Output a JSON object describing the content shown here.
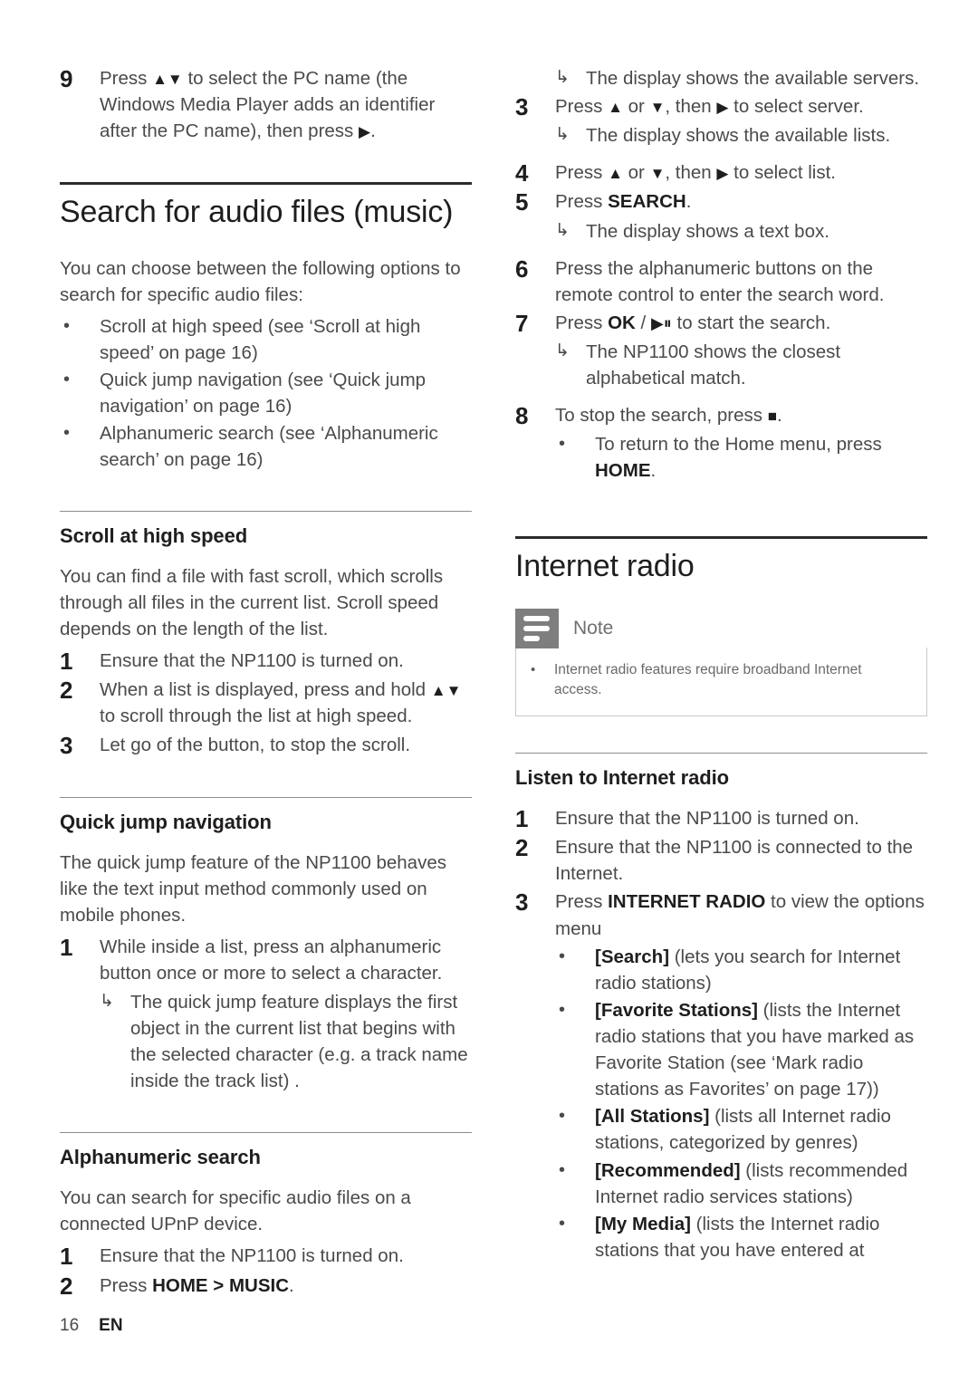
{
  "left_column": {
    "step9": {
      "number": "9",
      "text_before": "Press ",
      "glyph_updown": "▲▼",
      "text_mid": " to select the PC name (the Windows Media Player adds an identifier after the PC name), then press ",
      "glyph_right": "▶",
      "text_after": "."
    },
    "section_title": "Search for audio files (music)",
    "intro": "You can choose between the following options to search for specific audio files:",
    "options": [
      "Scroll at high speed (see ‘Scroll at high speed’ on page 16)",
      "Quick jump navigation (see ‘Quick jump navigation’ on page 16)",
      "Alphanumeric search (see ‘Alphanumeric search’ on page 16)"
    ],
    "scroll": {
      "title": "Scroll at high speed",
      "intro": "You can find a file with fast scroll, which scrolls through all files in the current list. Scroll speed depends on the length of the list.",
      "steps": [
        {
          "number": "1",
          "text": "Ensure that the NP1100 is turned on."
        },
        {
          "number": "2",
          "text_before": "When a list is displayed, press and hold ",
          "glyph": "▲▼",
          "text_after": " to scroll through the list at high speed."
        },
        {
          "number": "3",
          "text": "Let go of the button, to stop the scroll."
        }
      ]
    },
    "quickjump": {
      "title": "Quick jump navigation",
      "intro": "The quick jump feature of the NP1100 behaves like the text input method commonly used on mobile phones.",
      "step1": {
        "number": "1",
        "text": "While inside a list, press an alphanumeric button once or more to select a character."
      },
      "result": "The quick jump feature displays the first object in the current list that begins with the selected character (e.g. a track name inside the track list) ."
    },
    "alphanumeric": {
      "title": "Alphanumeric search",
      "intro": "You can search for specific audio files on a connected UPnP device.",
      "steps": [
        {
          "number": "1",
          "text": "Ensure that the NP1100 is turned on."
        },
        {
          "number": "2",
          "text_before": "Press ",
          "bold": "HOME > MUSIC",
          "text_after": "."
        }
      ]
    }
  },
  "right_column": {
    "result_servers": "The display shows the available servers.",
    "step3": {
      "number": "3",
      "text_before": "Press ",
      "glyph_up": "▲",
      "text_or": " or ",
      "glyph_down": "▼",
      "text_then": ", then ",
      "glyph_right": "▶",
      "text_after": " to select server.",
      "result": "The display shows the available lists."
    },
    "step4": {
      "number": "4",
      "text_before": "Press ",
      "glyph_up": "▲",
      "text_or": " or ",
      "glyph_down": "▼",
      "text_then": ", then ",
      "glyph_right": "▶",
      "text_after": " to select list."
    },
    "step5": {
      "number": "5",
      "text_before": "Press ",
      "bold": "SEARCH",
      "text_after": ".",
      "result": "The display shows a text box."
    },
    "step6": {
      "number": "6",
      "text": "Press the alphanumeric buttons on the remote control to enter the search word."
    },
    "step7": {
      "number": "7",
      "text_before": "Press ",
      "bold": "OK",
      "text_slash": " / ",
      "glyph_playpause": "▶⏸",
      "text_after": " to start the search.",
      "result": "The NP1100 shows the closest alphabetical match."
    },
    "step8": {
      "number": "8",
      "text_before": "To stop the search, press ",
      "glyph_stop": "■",
      "text_after": ".",
      "bullet_before": "To return to the Home menu, press ",
      "bullet_bold": "HOME",
      "bullet_after": "."
    },
    "internet_radio": {
      "section_title": "Internet radio",
      "note": {
        "icon": "note-icon",
        "label": "Note",
        "text": "Internet radio features require broadband Internet access."
      },
      "listen": {
        "title": "Listen to Internet radio",
        "steps": [
          {
            "number": "1",
            "text": "Ensure that the NP1100 is turned on."
          },
          {
            "number": "2",
            "text": "Ensure that the NP1100 is connected to the Internet."
          },
          {
            "number": "3",
            "text_before": "Press ",
            "bold": "INTERNET RADIO",
            "text_after": " to view the options menu"
          }
        ],
        "options": [
          {
            "label": "[Search]",
            "desc": " (lets you search for Internet radio stations)"
          },
          {
            "label": "[Favorite Stations]",
            "desc": " (lists the Internet radio stations that you have marked as Favorite Station (see ‘Mark radio stations as Favorites’ on page 17))"
          },
          {
            "label": "[All Stations]",
            "desc": " (lists all Internet radio stations, categorized by genres)"
          },
          {
            "label": "[Recommended]",
            "desc": " (lists recommended Internet radio services stations)"
          },
          {
            "label": "[My Media]",
            "desc": " (lists the Internet radio stations that you have entered at"
          }
        ]
      }
    }
  },
  "footer": {
    "page_number": "16",
    "language": "EN"
  },
  "bullet_char": "•",
  "arrow_char": "↳"
}
